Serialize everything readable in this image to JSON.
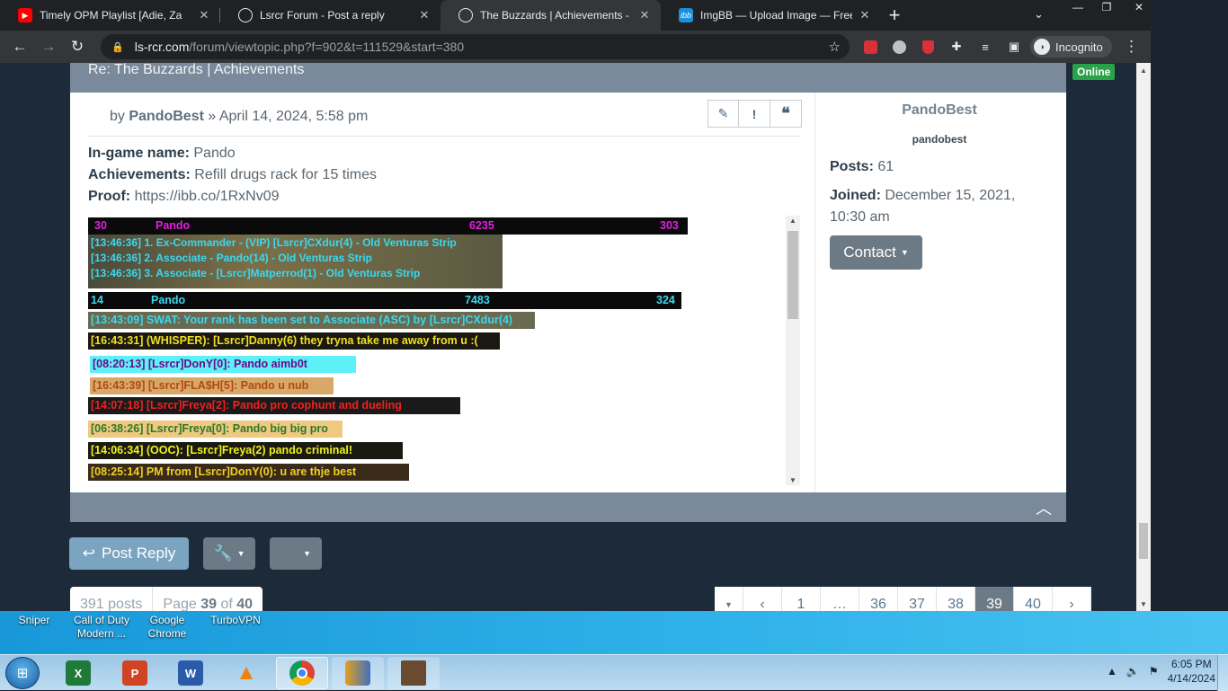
{
  "browser": {
    "tabs": [
      {
        "title": "Timely OPM Playlist [Adie, Za",
        "favicon": "youtube-icon",
        "favicon_color": "#ff0000",
        "active": false
      },
      {
        "title": "Lsrcr Forum - Post a reply",
        "favicon": "globe-icon",
        "favicon_color": "#e8eaed",
        "active": false
      },
      {
        "title": "The Buzzards | Achievements - Pa",
        "favicon": "globe-icon",
        "favicon_color": "#e8eaed",
        "active": true
      },
      {
        "title": "ImgBB — Upload Image — Free I",
        "favicon": "imgbb-icon",
        "favicon_color": "#1a8fdc",
        "favicon_text": "ibb",
        "active": false
      }
    ],
    "url_host": "ls-rcr.com",
    "url_path": "/forum/viewtopic.php?f=902&t=111529&start=380",
    "incognito_label": "Incognito"
  },
  "post": {
    "header_title": "Re: The Buzzards | Achievements",
    "online_badge": "Online",
    "by_prefix": "by",
    "author": "PandoBest",
    "date_sep": "»",
    "date": "April 14, 2024, 5:58 pm",
    "ingame_label": "In-game name:",
    "ingame_value": "Pando",
    "ach_label": "Achievements:",
    "ach_value": "Refill drugs rack for 15 times",
    "proof_label": "Proof:",
    "proof_value": "https://ibb.co/1RxNv09"
  },
  "screenshot_lines": {
    "score1": {
      "rank": "30",
      "name": "Pando",
      "score": "6235",
      "ping": "303"
    },
    "cmd1": "[13:46:36] 1. Ex-Commander - (VIP)  [Lsrcr]CXdur(4) - Old Venturas Strip",
    "cmd2": "[13:46:36] 2. Associate -  Pando(14) - Old Venturas Strip",
    "cmd3": "[13:46:36] 3. Associate - [Lsrcr]Matperrod(1) - Old Venturas Strip",
    "score2": {
      "rank": "14",
      "name": "Pando",
      "score": "7483",
      "ping": "324"
    },
    "chat": [
      "[13:43:09] SWAT: Your rank has been set to Associate (ASC) by [Lsrcr]CXdur(4)",
      "[16:43:31] (WHISPER): [Lsrcr]Danny(6) they tryna take me away from u :(",
      "[08:20:13] [Lsrcr]DonY[0]: Pando aimb0t",
      "[16:43:39] [Lsrcr]FLA$H[5]: Pando u nub",
      "[14:07:18] [Lsrcr]Freya[2]: Pando pro cophunt and dueling",
      "[06:38:26] [Lsrcr]Freya[0]: Pando big big pro",
      "[14:06:34] (OOC): [Lsrcr]Freya(2) pando criminal!",
      "[08:25:14] PM from [Lsrcr]DonY(0): u are thje best"
    ]
  },
  "profile": {
    "name": "PandoBest",
    "rank": "pandobest",
    "posts_label": "Posts:",
    "posts_value": "61",
    "joined_label": "Joined:",
    "joined_value": "December 15, 2021, 10:30 am",
    "contact_label": "Contact"
  },
  "actions": {
    "post_reply": "Post Reply"
  },
  "pagination": {
    "posts_count": "391 posts",
    "page_word": "Page",
    "page_current": "39",
    "of_word": "of",
    "page_total": "40",
    "pages": [
      "1",
      "…",
      "36",
      "37",
      "38",
      "39",
      "40"
    ],
    "current": "39"
  },
  "desktop_icons": [
    {
      "label": "Sniper"
    },
    {
      "label": "Call of Duty Modern ..."
    },
    {
      "label": "Google Chrome"
    },
    {
      "label": "TurboVPN"
    }
  ],
  "taskbar": {
    "time": "6:05 PM",
    "date": "4/14/2024"
  },
  "colors": {
    "accent": "#6c7a86",
    "online": "#2aa24a",
    "post_reply_btn": "#7ba4c0"
  }
}
